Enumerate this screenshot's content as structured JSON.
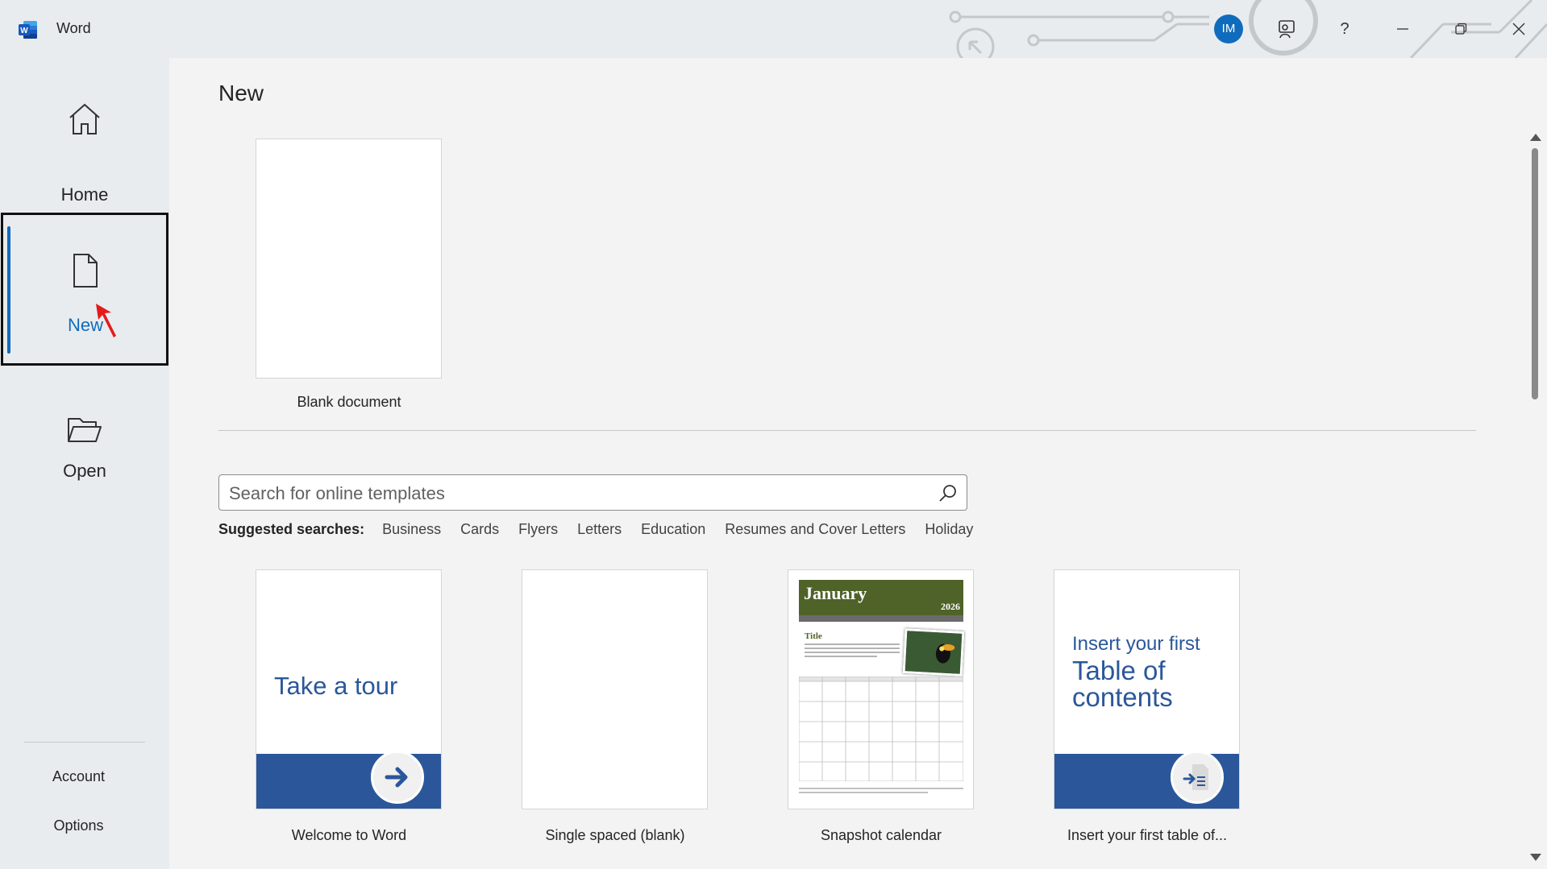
{
  "window": {
    "app_name": "Word",
    "avatar_initials": "IM",
    "help_label": "?",
    "accent_color": "#0f6cbd"
  },
  "sidebar": {
    "items": [
      {
        "label": "Home",
        "icon": "home-icon"
      },
      {
        "label": "New",
        "icon": "new-document-icon",
        "selected": true
      },
      {
        "label": "Open",
        "icon": "folder-open-icon"
      }
    ],
    "bottom_links": [
      {
        "label": "Account"
      },
      {
        "label": "Options"
      }
    ]
  },
  "main": {
    "title": "New",
    "blank": {
      "label": "Blank document"
    },
    "search": {
      "placeholder": "Search for online templates",
      "value": ""
    },
    "suggested": {
      "label": "Suggested searches:",
      "links": [
        "Business",
        "Cards",
        "Flyers",
        "Letters",
        "Education",
        "Resumes and Cover Letters",
        "Holiday"
      ]
    },
    "templates": [
      {
        "label": "Welcome to Word",
        "preview_text": "Take a tour"
      },
      {
        "label": "Single spaced (blank)"
      },
      {
        "label": "Snapshot calendar",
        "preview_month": "January",
        "preview_year": "2026",
        "preview_title": "Title"
      },
      {
        "label": "Insert your first table of...",
        "preview_line1": "Insert your first",
        "preview_line2": "Table of contents"
      }
    ]
  }
}
